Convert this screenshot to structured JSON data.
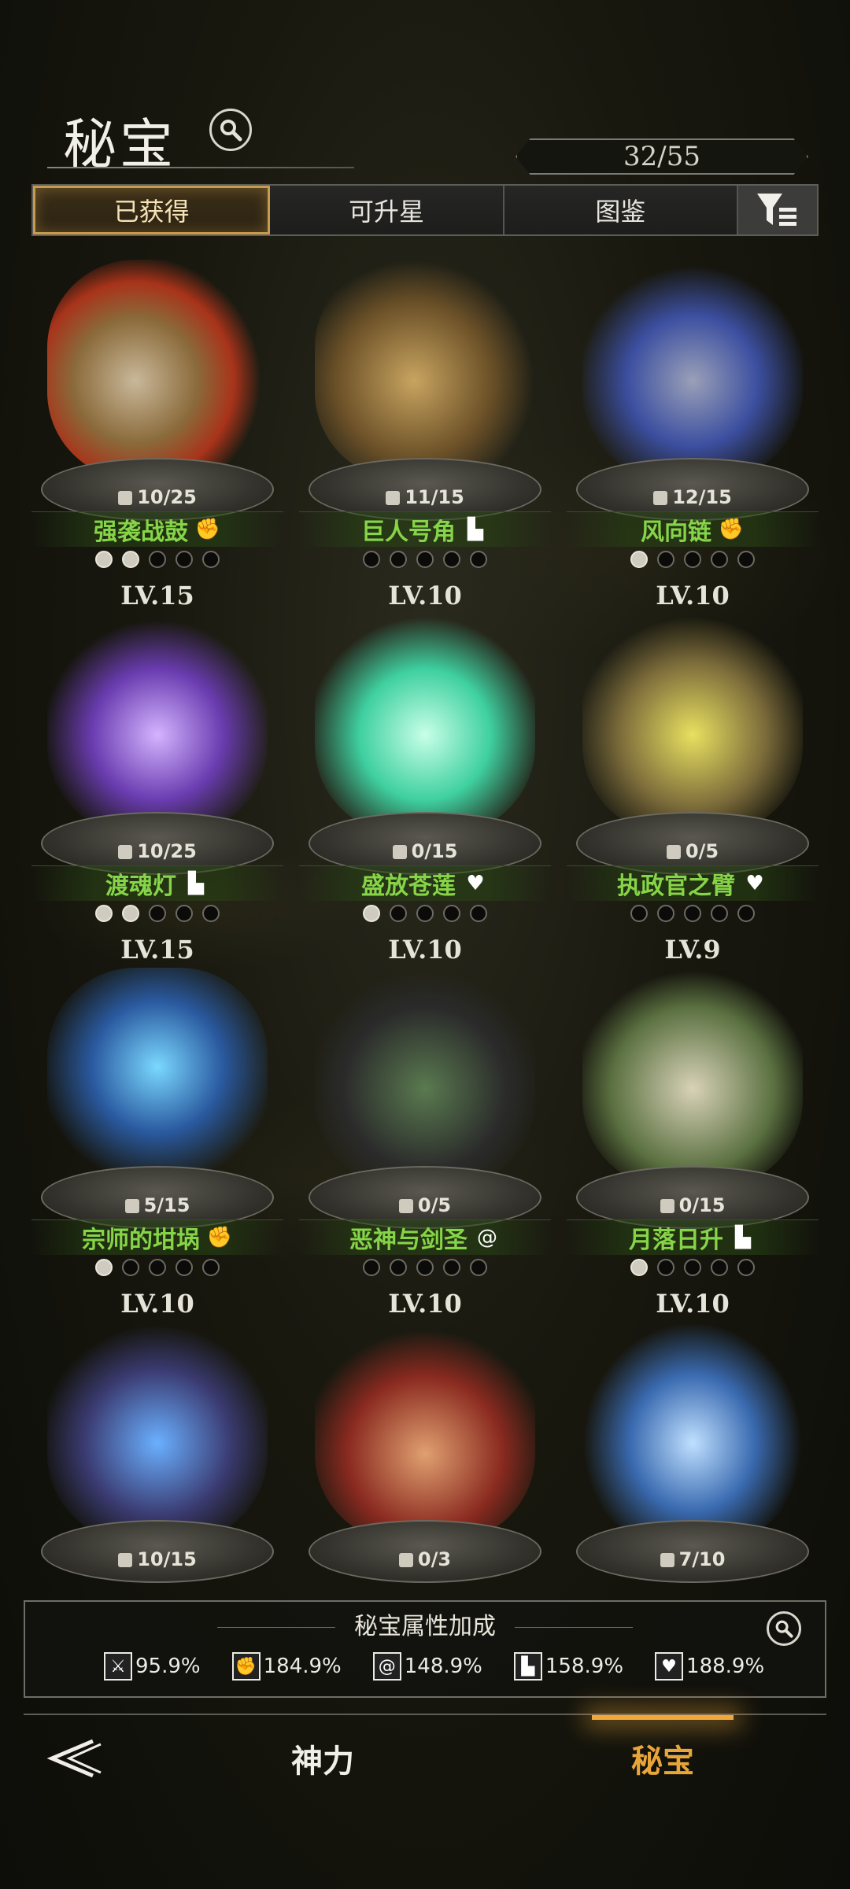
{
  "header": {
    "title": "秘宝",
    "counter": "32/55"
  },
  "tabs": [
    {
      "label": "已获得",
      "active": true
    },
    {
      "label": "可升星",
      "active": false
    },
    {
      "label": "图鉴",
      "active": false
    }
  ],
  "items": [
    {
      "fragments": "10/25",
      "name": "强袭战鼓",
      "type_icon": "fist-icon",
      "stars_on": 2,
      "level": "LV.15",
      "art": "war-drums"
    },
    {
      "fragments": "11/15",
      "name": "巨人号角",
      "type_icon": "boot-icon",
      "stars_on": 0,
      "level": "LV.10",
      "art": "giant-horn"
    },
    {
      "fragments": "12/15",
      "name": "风向链",
      "type_icon": "fist-icon",
      "stars_on": 1,
      "level": "LV.10",
      "art": "wind-necklace"
    },
    {
      "fragments": "10/25",
      "name": "渡魂灯",
      "type_icon": "boot-icon",
      "stars_on": 2,
      "level": "LV.15",
      "art": "soul-lantern"
    },
    {
      "fragments": "0/15",
      "name": "盛放苍莲",
      "type_icon": "heart-hand-icon",
      "stars_on": 1,
      "level": "LV.10",
      "art": "lotus"
    },
    {
      "fragments": "0/5",
      "name": "执政官之臂",
      "type_icon": "heart-hand-icon",
      "stars_on": 0,
      "level": "LV.9",
      "art": "gauntlet-arm"
    },
    {
      "fragments": "5/15",
      "name": "宗师的坩埚",
      "type_icon": "fist-icon",
      "stars_on": 1,
      "level": "LV.10",
      "art": "cauldron"
    },
    {
      "fragments": "0/5",
      "name": "恶神与剑圣",
      "type_icon": "swirl-icon",
      "stars_on": 0,
      "level": "LV.10",
      "art": "dark-card"
    },
    {
      "fragments": "0/15",
      "name": "月落日升",
      "type_icon": "boot-icon",
      "stars_on": 1,
      "level": "LV.10",
      "art": "moon-card"
    },
    {
      "fragments": "10/15",
      "art": "blue-gauntlet"
    },
    {
      "fragments": "0/3",
      "art": "candle"
    },
    {
      "fragments": "7/10",
      "art": "dagger"
    }
  ],
  "bonus": {
    "title": "秘宝属性加成",
    "stats": [
      {
        "icon": "sword-icon",
        "value": "95.9%"
      },
      {
        "icon": "fist-icon",
        "value": "184.9%"
      },
      {
        "icon": "swirl-icon",
        "value": "148.9%"
      },
      {
        "icon": "boot-icon",
        "value": "158.9%"
      },
      {
        "icon": "heart-hand-icon",
        "value": "188.9%"
      }
    ]
  },
  "nav": {
    "shenli": "神力",
    "mibao": "秘宝"
  },
  "colors": {
    "accent": "#e8a53a",
    "name_green": "#86d447"
  }
}
